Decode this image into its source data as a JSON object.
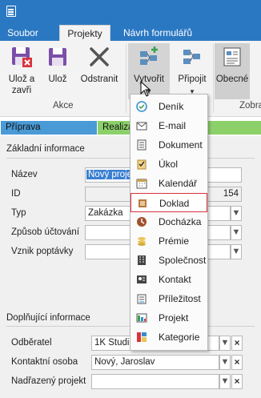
{
  "tabs": [
    {
      "label": "Soubor",
      "active": false
    },
    {
      "label": "Projekty",
      "active": true
    },
    {
      "label": "Návrh formulářů",
      "active": false
    }
  ],
  "ribbon": {
    "buttons": {
      "uloz_zavri": "Ulož a\nzavři",
      "uloz": "Ulož",
      "odstranit": "Odstranit",
      "vytvorit": "Vytvořit",
      "pripojit": "Připojit",
      "obecne": "Obecné"
    },
    "groups": {
      "akce": "Akce",
      "zobrazit": "Zobra"
    }
  },
  "stages": [
    {
      "label": "Příprava",
      "color": "#4a9ad6"
    },
    {
      "label": "Realiza",
      "color": "#8cd06a"
    }
  ],
  "form": {
    "basic_section": "Základní informace",
    "fields": {
      "nazev_label": "Název",
      "nazev_value": "Nový proje",
      "id_label": "ID",
      "id_value": "154",
      "typ_label": "Typ",
      "typ_value": "Zakázka",
      "zpusob_label": "Způsob účtování",
      "vznik_label": "Vznik poptávky"
    },
    "extra_section": "Doplňující informace",
    "extra_fields": {
      "odberatel_label": "Odběratel",
      "odberatel_value": "1K Studio",
      "kontaktni_label": "Kontaktní osoba",
      "kontaktni_value": "Nový, Jaroslav",
      "nadrazeny_label": "Nadřazený projekt"
    }
  },
  "menu": {
    "items": [
      {
        "label": "Deník",
        "icon": "journal-icon"
      },
      {
        "label": "E-mail",
        "icon": "email-icon"
      },
      {
        "label": "Dokument",
        "icon": "document-icon"
      },
      {
        "label": "Úkol",
        "icon": "task-icon"
      },
      {
        "label": "Kalendář",
        "icon": "calendar-icon"
      },
      {
        "label": "Doklad",
        "icon": "invoice-icon",
        "highlighted": true
      },
      {
        "label": "Docházka",
        "icon": "attendance-icon"
      },
      {
        "label": "Prémie",
        "icon": "bonus-icon"
      },
      {
        "label": "Společnost",
        "icon": "company-icon"
      },
      {
        "label": "Kontakt",
        "icon": "contact-icon"
      },
      {
        "label": "Příležitost",
        "icon": "opportunity-icon"
      },
      {
        "label": "Projekt",
        "icon": "project-icon"
      },
      {
        "label": "Kategorie",
        "icon": "category-icon"
      }
    ]
  },
  "colors": {
    "title_bar": "#2b78c2",
    "highlight_border": "#d9333d"
  }
}
